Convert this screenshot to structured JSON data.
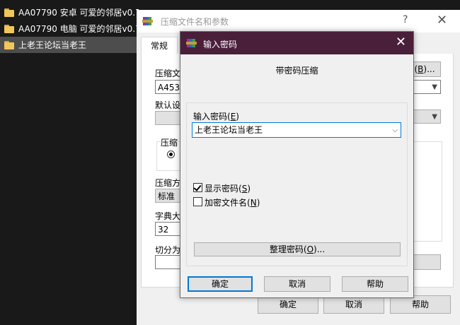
{
  "explorer": {
    "files": [
      {
        "name": "AA07790 安卓 可爱的邻居v0.7",
        "selected": false
      },
      {
        "name": "AA07790 电脑 可爱的邻居v0.7",
        "selected": false
      },
      {
        "name": "上老王论坛当老王",
        "selected": true
      }
    ]
  },
  "archive_window": {
    "title": "压缩文件名和参数",
    "help_glyph": "?",
    "close_glyph": "✕",
    "tab_general": "常规",
    "archive_name_label": "压缩文",
    "archive_name_value": "A4536",
    "browse_label_suffix": "B",
    "default_profile_label": "默认设",
    "compress_format_label": "压缩",
    "compress_method_label": "压缩方",
    "compress_method_value": "标准",
    "dict_size_label": "字典大",
    "dict_size_value": "32",
    "split_label": "切分为",
    "ok_button": "确定",
    "cancel_button": "取消",
    "help_button": "帮助"
  },
  "password_dialog": {
    "title": "输入密码",
    "close_glyph": "✕",
    "heading": "带密码压缩",
    "password_label": "输入密码",
    "password_label_key": "E",
    "password_value": "上老王论坛当老王",
    "show_password_label": "显示密码",
    "show_password_key": "S",
    "show_password_checked": true,
    "encrypt_names_label": "加密文件名",
    "encrypt_names_key": "N",
    "encrypt_names_checked": false,
    "organize_button": "整理密码",
    "organize_key": "O",
    "ok_button": "确定",
    "cancel_button": "取消",
    "help_button": "帮助"
  },
  "colors": {
    "dialog_titlebar": "#4a1f3a",
    "focus_border": "#0078d7",
    "desktop_bg": "#191919"
  }
}
